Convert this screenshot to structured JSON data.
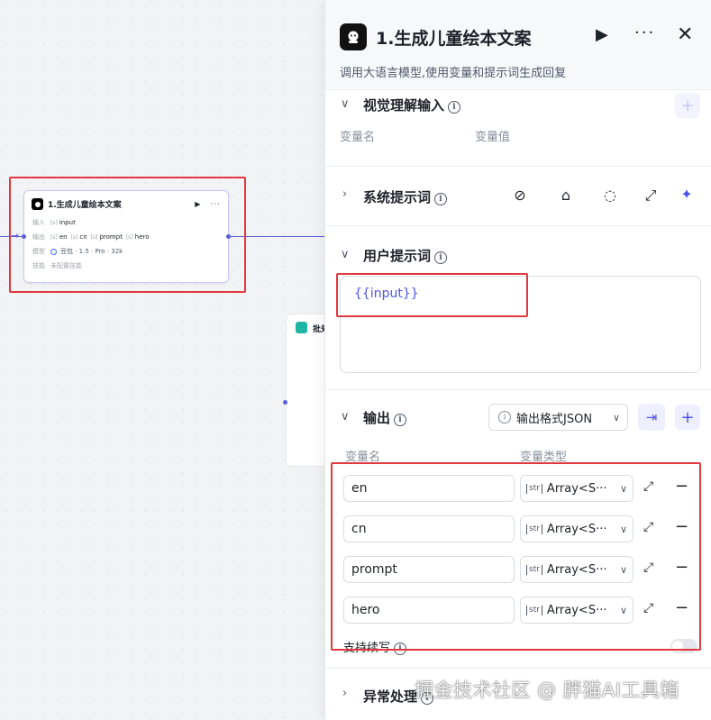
{
  "canvas": {
    "node": {
      "title": "1.生成儿童绘本文案",
      "run": "▶",
      "more": "···",
      "input_key": "输入",
      "input_tag": "input",
      "output_key": "输出",
      "outputs": [
        "en",
        "cn",
        "prompt",
        "hero"
      ],
      "model_key": "模型",
      "model_value": "豆包 · 1.5 · Pro · 32k",
      "skill_key": "技能",
      "skill_value": "未配置技能"
    },
    "batch_node": {
      "title": "批处"
    }
  },
  "panel": {
    "title": "1.生成儿童绘本文案",
    "description": "调用大语言模型,使用变量和提示词生成回复",
    "play": "▶",
    "more": "···",
    "close": "✕",
    "vision": {
      "title": "视觉理解输入",
      "col_name": "变量名",
      "col_value": "变量值"
    },
    "system_prompt": {
      "title": "系统提示词"
    },
    "user_prompt": {
      "title": "用户提示词",
      "content": "{{input}}"
    },
    "output": {
      "title": "输出",
      "format_label": "输出格式JSON",
      "col_name": "变量名",
      "col_type": "变量类型",
      "rows": [
        {
          "name": "en",
          "type": "Array<S···"
        },
        {
          "name": "cn",
          "type": "Array<S···"
        },
        {
          "name": "prompt",
          "type": "Array<S···"
        },
        {
          "name": "hero",
          "type": "Array<S···"
        }
      ],
      "type_badge": "str"
    },
    "continue_label": "支持续写",
    "exception": {
      "title": "异常处理"
    }
  },
  "watermark": "掘金技术社区 @ 胖猫AI工具箱",
  "colors": {
    "accent": "#4d53e8",
    "highlight": "#e0383e",
    "edge": "#5b5fd6"
  }
}
